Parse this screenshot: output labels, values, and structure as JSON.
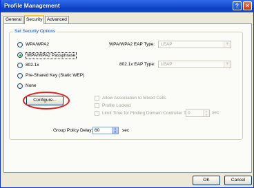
{
  "window": {
    "title": "Profile Management",
    "help_glyph": "?",
    "close_glyph": "✕"
  },
  "tabs": [
    {
      "label": "General"
    },
    {
      "label": "Security"
    },
    {
      "label": "Advanced"
    }
  ],
  "security_options": {
    "group_label": "Set Security Options",
    "options": [
      {
        "label": "WPA/WPA2",
        "selected": false
      },
      {
        "label": "WPA/WPA2 Passphrase",
        "selected": true
      },
      {
        "label": "802.1x",
        "selected": false
      },
      {
        "label": "Pre-Shared Key (Static WEP)",
        "selected": false
      },
      {
        "label": "None",
        "selected": false
      }
    ],
    "wpa_eap_type": {
      "label": "WPA/WPA2 EAP Type:",
      "value": "LEAP",
      "enabled": false
    },
    "eap_type_8021x": {
      "label": "802.1x EAP Type:",
      "value": "LEAP",
      "enabled": false
    },
    "configure_label": "Configure...",
    "checkboxes": [
      {
        "label": "Allow Association to Mixed Cells",
        "checked": false,
        "enabled": false
      },
      {
        "label": "Profile Locked",
        "checked": false,
        "enabled": false
      },
      {
        "label": "Limit Time for Finding Domain Controller To:",
        "checked": false,
        "enabled": false
      }
    ],
    "dc_timeout": {
      "value": "0",
      "unit": "sec",
      "enabled": false
    },
    "group_policy_delay": {
      "label": "Group Policy Delay:",
      "value": "60",
      "unit": "sec"
    }
  },
  "dialog_buttons": {
    "ok": "OK",
    "cancel": "Cancel"
  },
  "colors": {
    "title_bar": "#1c53d6",
    "accent_tab": "#ffc73c",
    "highlight_ring": "#e0201c",
    "radio_dot": "#21a121"
  }
}
